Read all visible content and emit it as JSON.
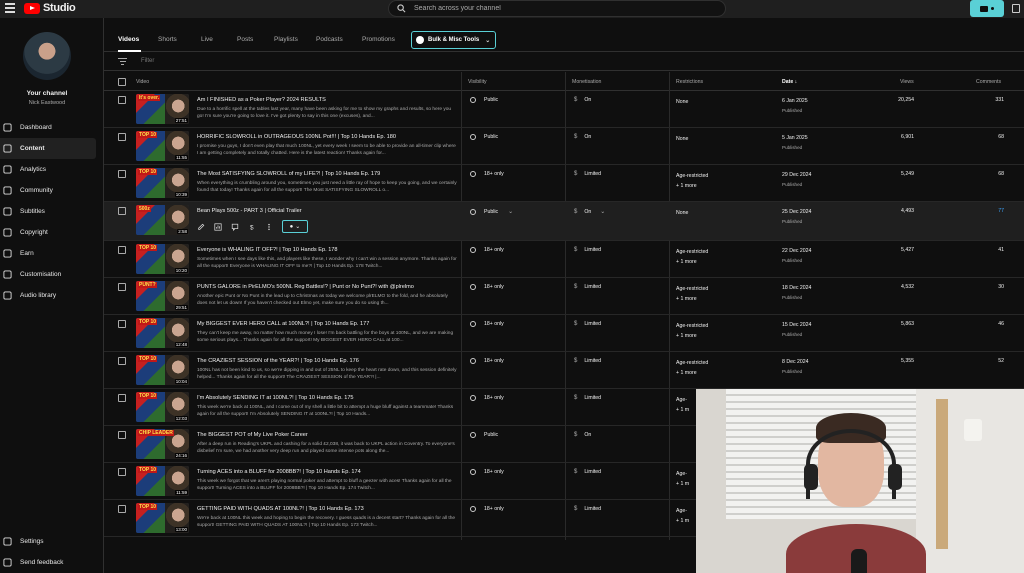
{
  "app": {
    "title": "Studio"
  },
  "search": {
    "placeholder": "Search across your channel"
  },
  "channel": {
    "title": "Your channel",
    "name": "Nick Eastwood"
  },
  "sidebar": {
    "items": [
      {
        "label": "Dashboard",
        "icon": "dashboard-icon"
      },
      {
        "label": "Content",
        "icon": "content-icon",
        "active": true
      },
      {
        "label": "Analytics",
        "icon": "analytics-icon"
      },
      {
        "label": "Community",
        "icon": "community-icon"
      },
      {
        "label": "Subtitles",
        "icon": "subtitles-icon"
      },
      {
        "label": "Copyright",
        "icon": "copyright-icon"
      },
      {
        "label": "Earn",
        "icon": "earn-icon"
      },
      {
        "label": "Customisation",
        "icon": "customisation-icon"
      },
      {
        "label": "Audio library",
        "icon": "audio-library-icon"
      }
    ],
    "bottom": [
      {
        "label": "Settings",
        "icon": "settings-icon"
      },
      {
        "label": "Send feedback",
        "icon": "feedback-icon"
      }
    ]
  },
  "tabs": [
    "Videos",
    "Shorts",
    "Live",
    "Posts",
    "Playlists",
    "Podcasts",
    "Promotions"
  ],
  "bulk_tools": {
    "label": "Bulk & Misc Tools"
  },
  "filter": {
    "placeholder": "Filter"
  },
  "columns": {
    "video": "Video",
    "visibility": "Visibility",
    "monetisation": "Monetisation",
    "restrictions": "Restrictions",
    "date": "Date ↓",
    "views": "Views",
    "comments": "Comments"
  },
  "rows": [
    {
      "title": "Am I FINISHED as a Poker Player? 2024 RESULTS",
      "desc": "Due to a horrific spell at the tables last year, many have been asking for me to show my graphs and results, so here you go! I'm sure you're going to love it. I've got plenty to say in this one (excuses), and...",
      "duration": "27:51",
      "tag": "It's over.",
      "visibility": "Public",
      "monetisation": "On",
      "restriction": "None",
      "restriction2": "",
      "date": "6 Jan 2025",
      "status": "Published",
      "views": "20,254",
      "comments": "331"
    },
    {
      "title": "HORRIFIC SLOWROLL in OUTRAGEOUS 100NL Pot!!! | Top 10 Hands Ep. 180",
      "desc": "I promise you guys, I don't even play that much 100NL, yet every week I seem to be able to provide an all-timer clip where I am getting completely and totally chatted. Here is the latest reaction! Thanks again for...",
      "duration": "11:55",
      "tag": "TOP 10",
      "visibility": "Public",
      "monetisation": "On",
      "restriction": "None",
      "restriction2": "",
      "date": "5 Jan 2025",
      "status": "Published",
      "views": "6,901",
      "comments": "68"
    },
    {
      "title": "The Most SATISFYING SLOWROLL of my LIFE?! | Top 10 Hands Ep. 179",
      "desc": "When everything is crumbling around you, sometimes you just need a little ray of hope to keep you going, and we certainly found that today! Thanks again for all the support! The Most SATISFYING SLOWROLL o...",
      "duration": "10:39",
      "tag": "TOP 10",
      "visibility": "18+ only",
      "monetisation": "Limited",
      "restriction": "Age-restricted",
      "restriction2": "+ 1 more",
      "date": "29 Dec 2024",
      "status": "Published",
      "views": "5,249",
      "comments": "68"
    },
    {
      "title": "Bean Plays 500z - PART 3 | Official Trailer",
      "desc": "",
      "duration": "2:58",
      "tag": "500z",
      "visibility": "Public",
      "monetisation": "On",
      "restriction": "None",
      "restriction2": "",
      "date": "25 Dec 2024",
      "status": "Published",
      "views": "4,493",
      "comments": "77",
      "hover": true
    },
    {
      "title": "Everyone is WHALING IT OFF?! | Top 10 Hands Ep. 178",
      "desc": "Sometimes when I see days like this, and players like these, I wonder why I can't win a session anymore. Thanks again for all the support! Everyone is WHALING IT OFF to me?! | Top 10 Hands Ep. 178 Twitch...",
      "duration": "10:20",
      "tag": "TOP 10",
      "visibility": "18+ only",
      "monetisation": "Limited",
      "restriction": "Age-restricted",
      "restriction2": "+ 1 more",
      "date": "22 Dec 2024",
      "status": "Published",
      "views": "5,427",
      "comments": "41"
    },
    {
      "title": "PUNTS GALORE in PirELMO's 500NL Reg Battles!? | Punt or No Punt?! with @plrelmo",
      "desc": "Another epic Punt or No Punt in the lead up to Christmas as today we welcome plrELMO to the fold, and he absolutely does not let us down! If you haven't checked out Elmo yet, make sure you do so using th...",
      "duration": "29:51",
      "tag": "PUNT?",
      "visibility": "18+ only",
      "monetisation": "Limited",
      "restriction": "Age-restricted",
      "restriction2": "+ 1 more",
      "date": "18 Dec 2024",
      "status": "Published",
      "views": "4,532",
      "comments": "30"
    },
    {
      "title": "My BIGGEST EVER HERO CALL at 100NL?! | Top 10 Hands Ep. 177",
      "desc": "They can't keep me away, no matter how much money I lose! I'm back battling for the boys at 100NL, and we are making some serious plays... Thanks again for all the support! My BIGGEST EVER HERO CALL at 100...",
      "duration": "12:48",
      "tag": "TOP 10",
      "visibility": "18+ only",
      "monetisation": "Limited",
      "restriction": "Age-restricted",
      "restriction2": "+ 1 more",
      "date": "15 Dec 2024",
      "status": "Published",
      "views": "5,863",
      "comments": "46"
    },
    {
      "title": "The CRAZIEST SESSION of the YEAR?! | Top 10 Hands Ep. 176",
      "desc": "100NL has not been kind to us, so we're dipping in and out of 25NL to keep the heart rate down, and this session definitely helped... Thanks again for all the support! The CRAZIEST SESSION of the YEAR?! |...",
      "duration": "10:04",
      "tag": "TOP 10",
      "visibility": "18+ only",
      "monetisation": "Limited",
      "restriction": "Age-restricted",
      "restriction2": "+ 1 more",
      "date": "8 Dec 2024",
      "status": "Published",
      "views": "5,355",
      "comments": "52"
    },
    {
      "title": "I'm Absolutely SENDING IT at 100NL?! | Top 10 Hands Ep. 175",
      "desc": "This week we're back at 100NL, and I come out of my shell a little bit to attempt a huge bluff against a teammate! Thanks again for all the support! I'm Absolutely SENDING IT at 100NL?! | Top 10 Hands...",
      "duration": "12:03",
      "tag": "TOP 10",
      "visibility": "18+ only",
      "monetisation": "Limited",
      "restriction": "Age-",
      "restriction2": "+ 1 m",
      "date": "",
      "status": "",
      "views": "",
      "comments": ""
    },
    {
      "title": "The BIGGEST POT of My Live Poker Career",
      "desc": "After a deep run in Reading's UKPL and cashing for a solid £2,038, it was back to UKPL action in Coventry. To everyone's disbelief I'm sure, we had another very deep run and played some intense pots along the...",
      "duration": "24:16",
      "tag": "CHIP LEADER",
      "visibility": "Public",
      "monetisation": "On",
      "restriction": "",
      "restriction2": "",
      "date": "",
      "status": "",
      "views": "",
      "comments": ""
    },
    {
      "title": "Turning ACES into a BLUFF for 2008BB?! | Top 10 Hands Ep. 174",
      "desc": "This week we forgot that we aren't playing normal poker and attempt to bluff a geezer with aces! Thanks again for all the support! Turning ACES into a BLUFF for 2008BB?! | Top 10 Hands Ep. 174 Twitch...",
      "duration": "11:59",
      "tag": "TOP 10",
      "visibility": "18+ only",
      "monetisation": "Limited",
      "restriction": "Age-",
      "restriction2": "+ 1 m",
      "date": "",
      "status": "",
      "views": "",
      "comments": ""
    },
    {
      "title": "GETTING PAID WITH QUADS AT 100NL?! | Top 10 Hands Ep. 173",
      "desc": "We're back at 100NL this week and hoping to begin the recovery. I guess quads is a decent start? Thanks again for all the support! GETTING PAID WITH QUADS AT 100NL?! | Top 10 Hands Ep. 173 Twitch...",
      "duration": "13:00",
      "tag": "TOP 10",
      "visibility": "18+ only",
      "monetisation": "Limited",
      "restriction": "Age-",
      "restriction2": "+ 1 m",
      "date": "",
      "status": "",
      "views": "",
      "comments": ""
    }
  ],
  "colors": {
    "accent": "#5ad0d6",
    "link": "#3ea6ff",
    "brand": "#ff0000"
  }
}
